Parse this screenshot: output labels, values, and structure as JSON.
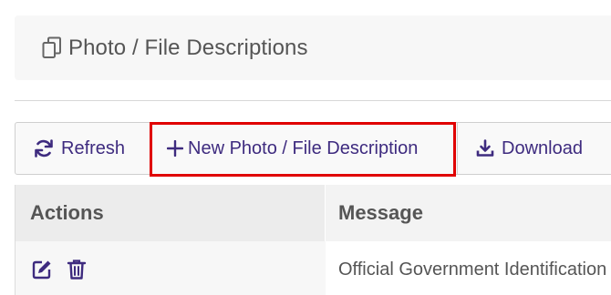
{
  "header": {
    "title": "Photo / File Descriptions",
    "icon": "copy-icon"
  },
  "toolbar": {
    "refresh_label": "Refresh",
    "refresh_icon": "refresh-icon",
    "new_label": "New Photo / File Description",
    "new_icon": "plus-icon",
    "download_label": "Download",
    "download_icon": "download-icon"
  },
  "table": {
    "columns": [
      "Actions",
      "Message"
    ],
    "rows": [
      {
        "message": "Official Government Identification"
      }
    ]
  },
  "colors": {
    "accent": "#3e2b7f",
    "highlight": "#e00000",
    "text": "#555555"
  }
}
